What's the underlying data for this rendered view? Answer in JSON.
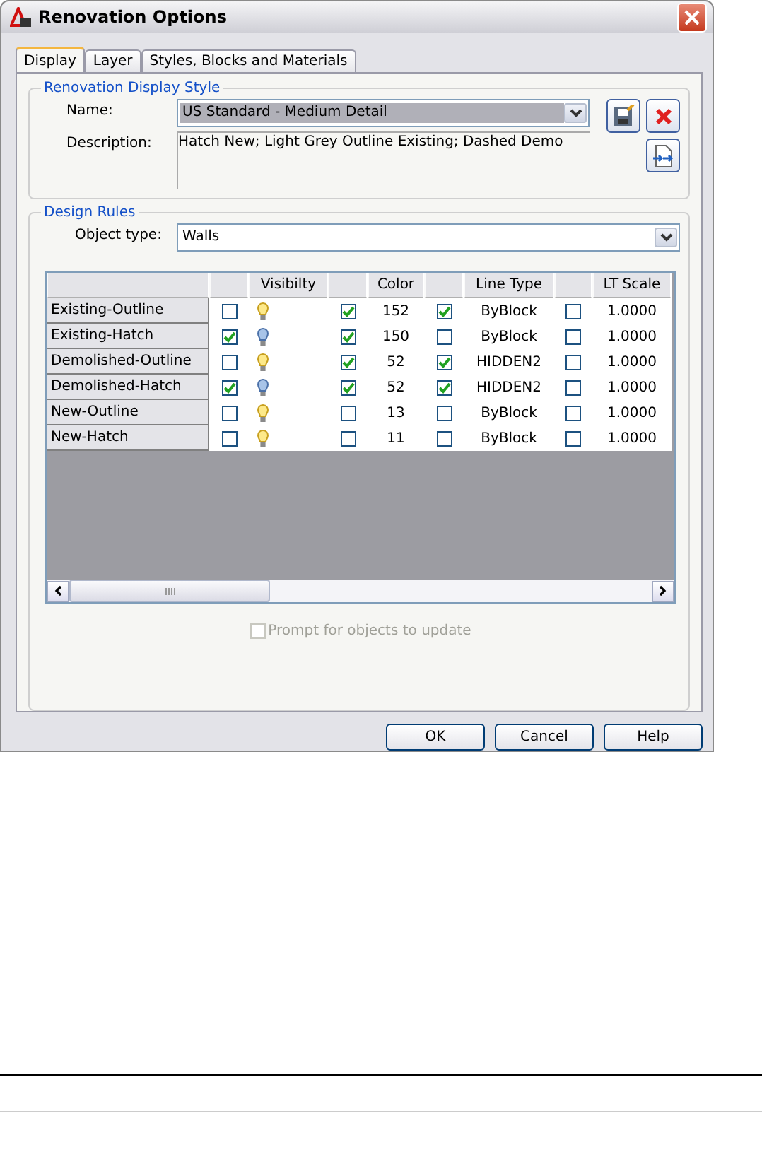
{
  "window": {
    "title": "Renovation Options"
  },
  "tabs": [
    {
      "label": "Display",
      "selected": true
    },
    {
      "label": "Layer",
      "selected": false
    },
    {
      "label": "Styles, Blocks and Materials",
      "selected": false
    }
  ],
  "display_style": {
    "group_title": "Renovation Display Style",
    "name_label": "Name:",
    "name_value": "US Standard - Medium Detail",
    "description_label": "Description:",
    "description_value": "Hatch New; Light Grey Outline Existing; Dashed Demo"
  },
  "design_rules": {
    "group_title": "Design Rules",
    "object_type_label": "Object type:",
    "object_type_value": "Walls"
  },
  "table": {
    "columns": [
      "Visibilty",
      "Color",
      "Line Type",
      "LT Scale"
    ],
    "rows": [
      {
        "name": "Existing-Outline",
        "visibility_override": false,
        "visible": true,
        "color_override": true,
        "color_index": "152",
        "linetype_override": true,
        "linetype": "ByBlock",
        "ltscale_override": false,
        "ltscale": "1.0000"
      },
      {
        "name": "Existing-Hatch",
        "visibility_override": true,
        "visible": false,
        "color_override": true,
        "color_index": "150",
        "linetype_override": false,
        "linetype": "ByBlock",
        "ltscale_override": false,
        "ltscale": "1.0000"
      },
      {
        "name": "Demolished-Outline",
        "visibility_override": false,
        "visible": true,
        "color_override": true,
        "color_index": "52",
        "linetype_override": true,
        "linetype": "HIDDEN2",
        "ltscale_override": false,
        "ltscale": "1.0000"
      },
      {
        "name": "Demolished-Hatch",
        "visibility_override": true,
        "visible": false,
        "color_override": true,
        "color_index": "52",
        "linetype_override": true,
        "linetype": "HIDDEN2",
        "ltscale_override": false,
        "ltscale": "1.0000"
      },
      {
        "name": "New-Outline",
        "visibility_override": false,
        "visible": true,
        "color_override": false,
        "color_index": "13",
        "linetype_override": false,
        "linetype": "ByBlock",
        "ltscale_override": false,
        "ltscale": "1.0000"
      },
      {
        "name": "New-Hatch",
        "visibility_override": false,
        "visible": true,
        "color_override": false,
        "color_index": "11",
        "linetype_override": false,
        "linetype": "ByBlock",
        "ltscale_override": false,
        "ltscale": "1.0000"
      }
    ]
  },
  "prompt": {
    "label": "Prompt for objects to update",
    "checked": false,
    "disabled": true
  },
  "buttons": [
    "OK",
    "Cancel",
    "Help"
  ]
}
